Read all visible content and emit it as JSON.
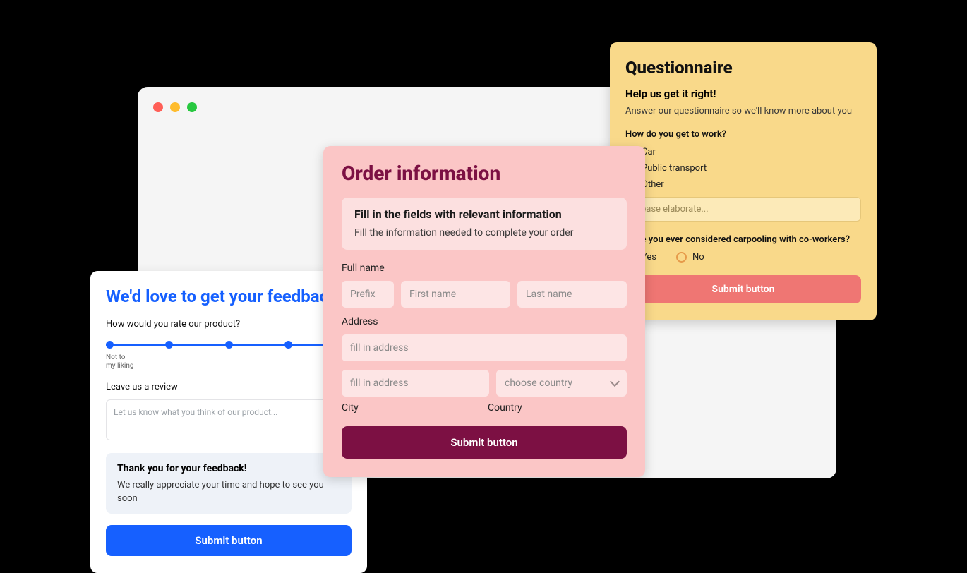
{
  "feedback": {
    "title": "We'd love to get your feedback",
    "rate_q": "How would you rate our product?",
    "slider_min": "Not to\nmy liking",
    "review_label": "Leave us a review",
    "review_placeholder": "Let us know what you think of our product...",
    "thanks_title": "Thank you for your feedback!",
    "thanks_body": "We really appreciate your time and hope to see you soon",
    "submit": "Submit button"
  },
  "order": {
    "title": "Order information",
    "panel_title": "Fill in the fields with relevant information",
    "panel_body": "Fill the information needed to complete your order",
    "fullname_label": "Full name",
    "prefix_ph": "Prefix",
    "first_ph": "First name",
    "last_ph": "Last name",
    "address_label": "Address",
    "address_ph": "fill in address",
    "address2_ph": "fill in address",
    "country_ph": "choose country",
    "city_label": "City",
    "country_label": "Country",
    "submit": "Submit button"
  },
  "quest": {
    "title": "Questionnaire",
    "help_title": "Help us get it right!",
    "help_body": "Answer our questionnaire so we'll know more about you",
    "q1": "How do you get to work?",
    "q1_opts": {
      "a": "Car",
      "b": "Public transport",
      "c": "Other"
    },
    "elaborate_ph": "Please elaborate...",
    "q2": "Have you ever considered carpooling with co-workers?",
    "q2_opts": {
      "yes": "Yes",
      "no": "No"
    },
    "submit": "Submit button"
  }
}
